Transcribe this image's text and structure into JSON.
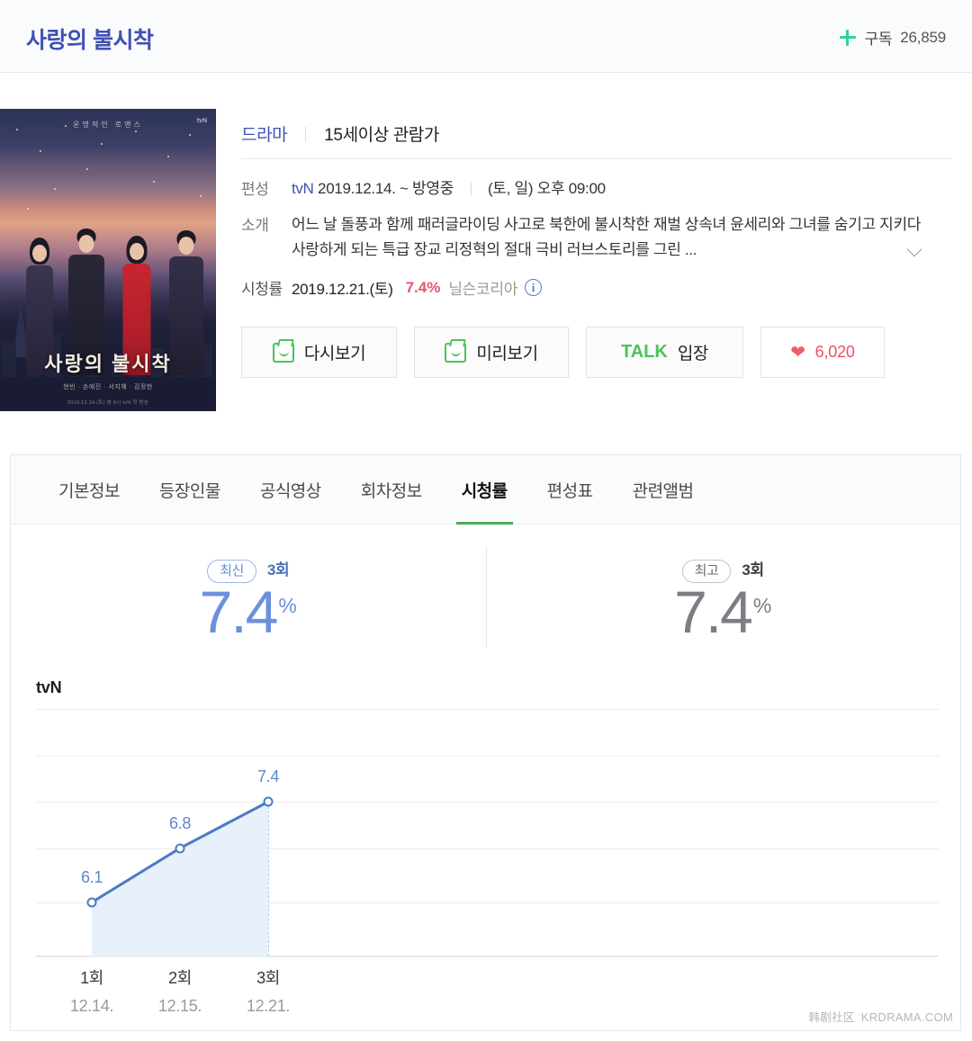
{
  "header": {
    "title": "사랑의 불시착",
    "subscribe_label": "구독",
    "subscribe_count": "26,859",
    "plus_icon": "plus-icon",
    "title_color": "#3f51b5",
    "plus_color": "#2fd39b"
  },
  "poster": {
    "title_text": "사랑의 불시착",
    "top_line": "운명적인 로맨스",
    "credits": "현빈 · 손예진 · 서지혜 · 김정현",
    "footer": "2019.12.14.(토) 밤 9시 tvN 첫 방송",
    "channel_mark": "tvN"
  },
  "info": {
    "genre": "드라마",
    "age_rating": "15세이상 관람가",
    "schedule": {
      "label": "편성",
      "channel": "tvN",
      "period": "2019.12.14. ~ 방영중",
      "airtime": "(토, 일) 오후 09:00"
    },
    "synopsis": {
      "label": "소개",
      "text": "어느 날 돌풍과 함께 패러글라이딩 사고로 북한에 불시착한 재벌 상속녀 윤세리와 그녀를 숨기고 지키다 사랑하게 되는 특급 장교 리정혁의 절대 극비 러브스토리를 그린 ...",
      "expand_icon": "chevron-down-icon"
    },
    "rating": {
      "label": "시청률",
      "date": "2019.12.21.(토)",
      "value": "7.4%",
      "source": "닐슨코리아",
      "info_icon": "info-icon",
      "value_color": "#e8536b"
    }
  },
  "buttons": [
    {
      "name": "rewatch-button",
      "label": "다시보기",
      "icon": "tv-screen-icon"
    },
    {
      "name": "preview-button",
      "label": "미리보기",
      "icon": "tv-screen-icon"
    },
    {
      "name": "talk-enter-button",
      "mark": "TALK",
      "label": "입장"
    },
    {
      "name": "like-button",
      "icon": "heart-icon",
      "count": "6,020"
    }
  ],
  "tabs": [
    {
      "label": "기본정보",
      "active": false
    },
    {
      "label": "등장인물",
      "active": false
    },
    {
      "label": "공식영상",
      "active": false
    },
    {
      "label": "회차정보",
      "active": false
    },
    {
      "label": "시청률",
      "active": true
    },
    {
      "label": "편성표",
      "active": false
    },
    {
      "label": "관련앨범",
      "active": false
    }
  ],
  "stats": [
    {
      "badge": "최신",
      "episode": "3회",
      "value": "7.4",
      "unit": "%",
      "style": "blue"
    },
    {
      "badge": "최고",
      "episode": "3회",
      "value": "7.4",
      "unit": "%",
      "style": "gray"
    }
  ],
  "chart_data": {
    "type": "line",
    "title": "tvN",
    "xlabel": "",
    "ylabel": "",
    "categories": [
      "1회",
      "2회",
      "3회"
    ],
    "x_sublabels": [
      "12.14.",
      "12.15.",
      "12.21."
    ],
    "values": [
      6.1,
      6.8,
      7.4
    ],
    "point_labels": [
      "6.1",
      "6.8",
      "7.4"
    ],
    "series": [
      {
        "name": "tvN",
        "values": [
          6.1,
          6.8,
          7.4
        ]
      }
    ],
    "ylim": [
      5.4,
      8.6
    ],
    "gridlines": [
      8.6,
      8.0,
      7.4,
      6.8,
      6.1,
      5.4
    ],
    "grid": true,
    "legend": "none",
    "line_color": "#4a7bc4",
    "area_color": "#e8f0fb",
    "label_color": "#5e87c8"
  },
  "watermark": {
    "cn": "韩剧社区",
    "site": "KRDRAMA.COM"
  }
}
